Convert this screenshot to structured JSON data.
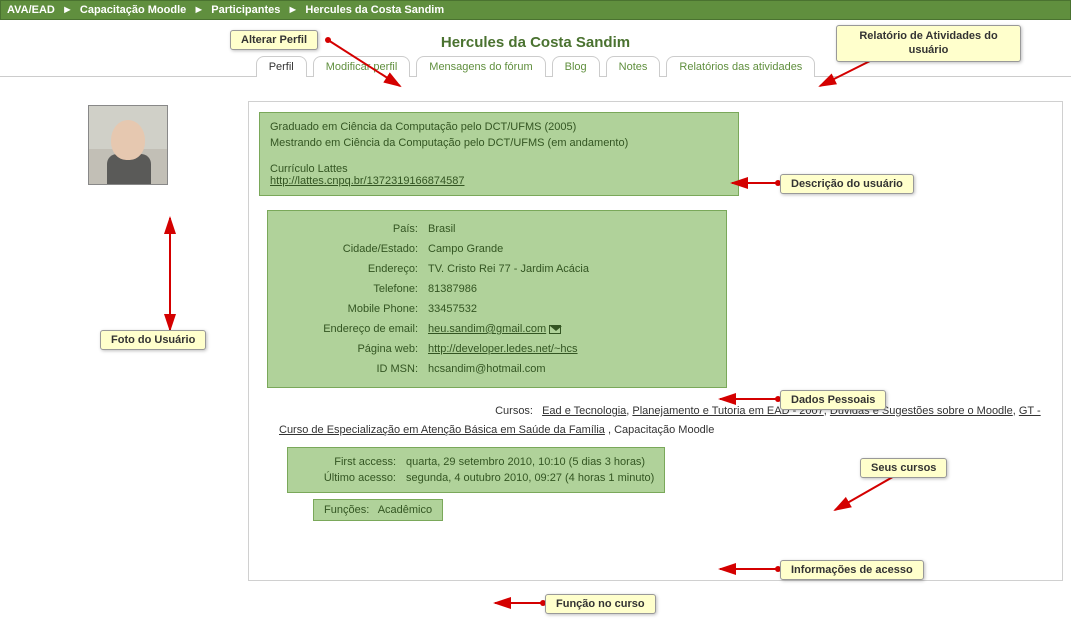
{
  "breadcrumb": {
    "items": [
      "AVA/EAD",
      "Capacitação Moodle",
      "Participantes",
      "Hercules da Costa Sandim"
    ],
    "sep": "►"
  },
  "title": "Hercules da Costa Sandim",
  "tabs": [
    {
      "label": "Perfil",
      "active": true
    },
    {
      "label": "Modificar perfil",
      "active": false
    },
    {
      "label": "Mensagens do fórum",
      "active": false
    },
    {
      "label": "Blog",
      "active": false
    },
    {
      "label": "Notes",
      "active": false
    },
    {
      "label": "Relatórios das atividades",
      "active": false
    }
  ],
  "description": {
    "line1": "Graduado em Ciência da Computação pelo DCT/UFMS (2005)",
    "line2": "Mestrando em Ciência da Computação pelo DCT/UFMS (em andamento)",
    "lattes_label": "Currículo Lattes",
    "lattes_link": "http://lattes.cnpq.br/1372319166874587"
  },
  "details": {
    "country": {
      "label": "País:",
      "value": "Brasil"
    },
    "city": {
      "label": "Cidade/Estado:",
      "value": "Campo Grande"
    },
    "address": {
      "label": "Endereço:",
      "value": "TV. Cristo Rei 77 - Jardim Acácia"
    },
    "phone": {
      "label": "Telefone:",
      "value": "81387986"
    },
    "mobile": {
      "label": "Mobile Phone:",
      "value": "33457532"
    },
    "email": {
      "label": "Endereço de email:",
      "value": "heu.sandim@gmail.com"
    },
    "web": {
      "label": "Página web:",
      "value": "http://developer.ledes.net/~hcs"
    },
    "msn": {
      "label": "ID MSN:",
      "value": "hcsandim@hotmail.com"
    }
  },
  "courses": {
    "label": "Cursos:",
    "links": [
      "Ead e Tecnologia",
      "Planejamento e Tutoria em EAD - 2007",
      "Dúvidas e Sugestões sobre o Moodle",
      "GT - Curso de Especialização em Atenção Básica em Saúde da Família"
    ],
    "plain": "Capacitação Moodle"
  },
  "access": {
    "first": {
      "label": "First access:",
      "value": "quarta, 29 setembro 2010, 10:10  (5 dias 3 horas)"
    },
    "last": {
      "label": "Último acesso:",
      "value": "segunda, 4 outubro 2010, 09:27  (4 horas 1 minuto)"
    }
  },
  "roles": {
    "label": "Funções:",
    "value": "Acadêmico"
  },
  "callouts": {
    "alterar_perfil": "Alterar Perfil",
    "relatorio": "Relatório de Atividades do usuário",
    "foto": "Foto do Usuário",
    "descricao": "Descrição do usuário",
    "dados": "Dados Pessoais",
    "cursos": "Seus cursos",
    "acesso": "Informações de acesso",
    "funcao": "Função no curso"
  }
}
